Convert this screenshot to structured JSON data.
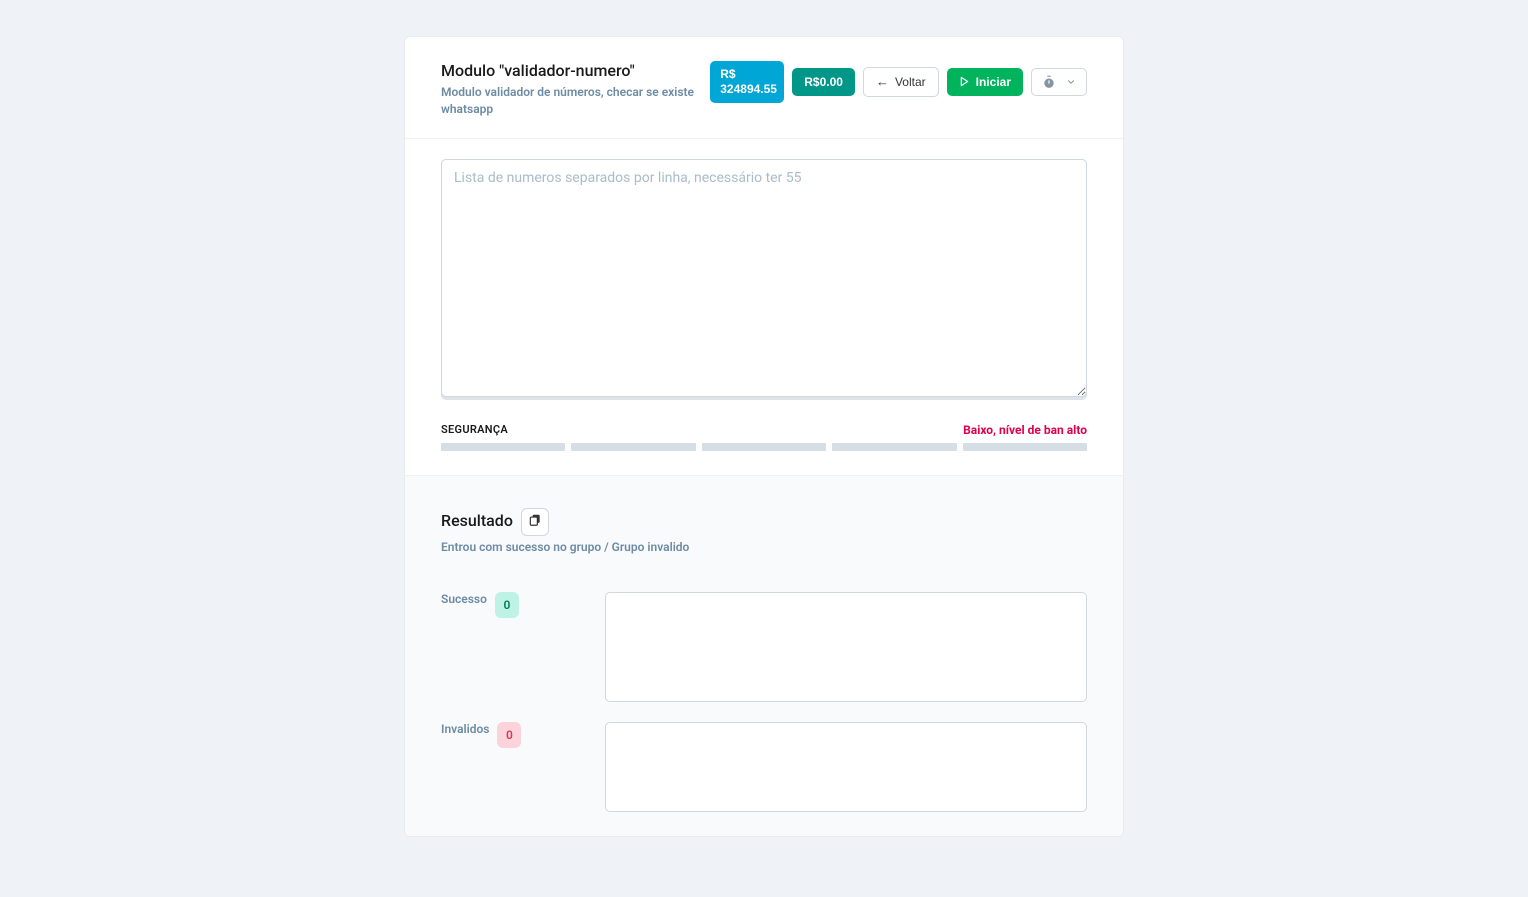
{
  "header": {
    "title": "Modulo \"validador-numero\"",
    "subtitle": "Modulo validador de números, checar se existe whatsapp",
    "balance": "R$ 324894.55",
    "cost": "R$0.00",
    "back_label": "Voltar",
    "start_label": "Iniciar"
  },
  "input": {
    "placeholder": "Lista de numeros separados por linha, necessário ter 55",
    "value": ""
  },
  "security": {
    "label": "SEGURANÇA",
    "status": "Baixo, nível de ban alto"
  },
  "result": {
    "title": "Resultado",
    "subtitle": "Entrou com sucesso no grupo / Grupo invalido",
    "success_label": "Sucesso",
    "success_count": "0",
    "success_output": "",
    "invalid_label": "Invalidos",
    "invalid_count": "0",
    "invalid_output": ""
  }
}
